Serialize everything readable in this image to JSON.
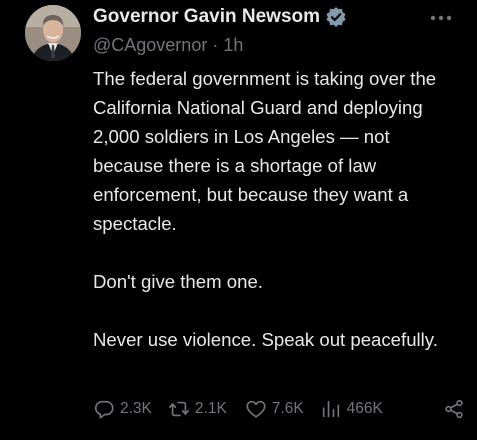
{
  "author": {
    "display_name": "Governor Gavin Newsom",
    "handle": "@CAgovernor",
    "separator": "·",
    "time": "1h",
    "verified_icon": "verified-badge-icon",
    "verified_color": "#829aab"
  },
  "tweet": {
    "paragraphs": [
      "The federal government is taking over the California National Guard and deploying 2,000 soldiers in Los Angeles — not because there is a shortage of law enforcement, but because they want a spectacle.",
      "Don't give them one.",
      "Never use violence. Speak out peacefully."
    ]
  },
  "actions": {
    "replies": "2.3K",
    "retweets": "2.1K",
    "likes": "7.6K",
    "views": "466K"
  },
  "icons": {
    "more": "more-icon",
    "reply": "reply-icon",
    "retweet": "retweet-icon",
    "like": "heart-icon",
    "views": "views-icon",
    "share": "share-icon"
  },
  "colors": {
    "background": "#000000",
    "primary_text": "#e7e9ea",
    "secondary_text": "#71767b"
  }
}
